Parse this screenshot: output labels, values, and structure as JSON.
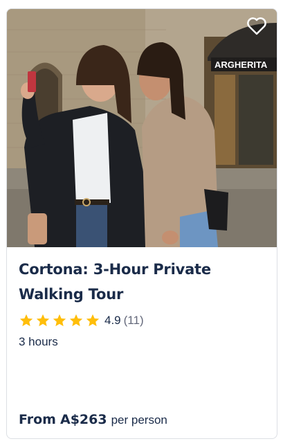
{
  "card": {
    "title": "Cortona: 3-Hour Private Walking Tour",
    "rating": {
      "value": "4.9",
      "count": "(11)",
      "stars": 5
    },
    "duration": "3 hours",
    "price": {
      "from_label": "From",
      "amount": "A$263",
      "unit": "per person"
    },
    "image": {
      "shop_sign": "ARGHERITA"
    },
    "colors": {
      "star": "#ffbe0a",
      "text": "#1a2b49",
      "border": "#dcdfe4"
    }
  }
}
